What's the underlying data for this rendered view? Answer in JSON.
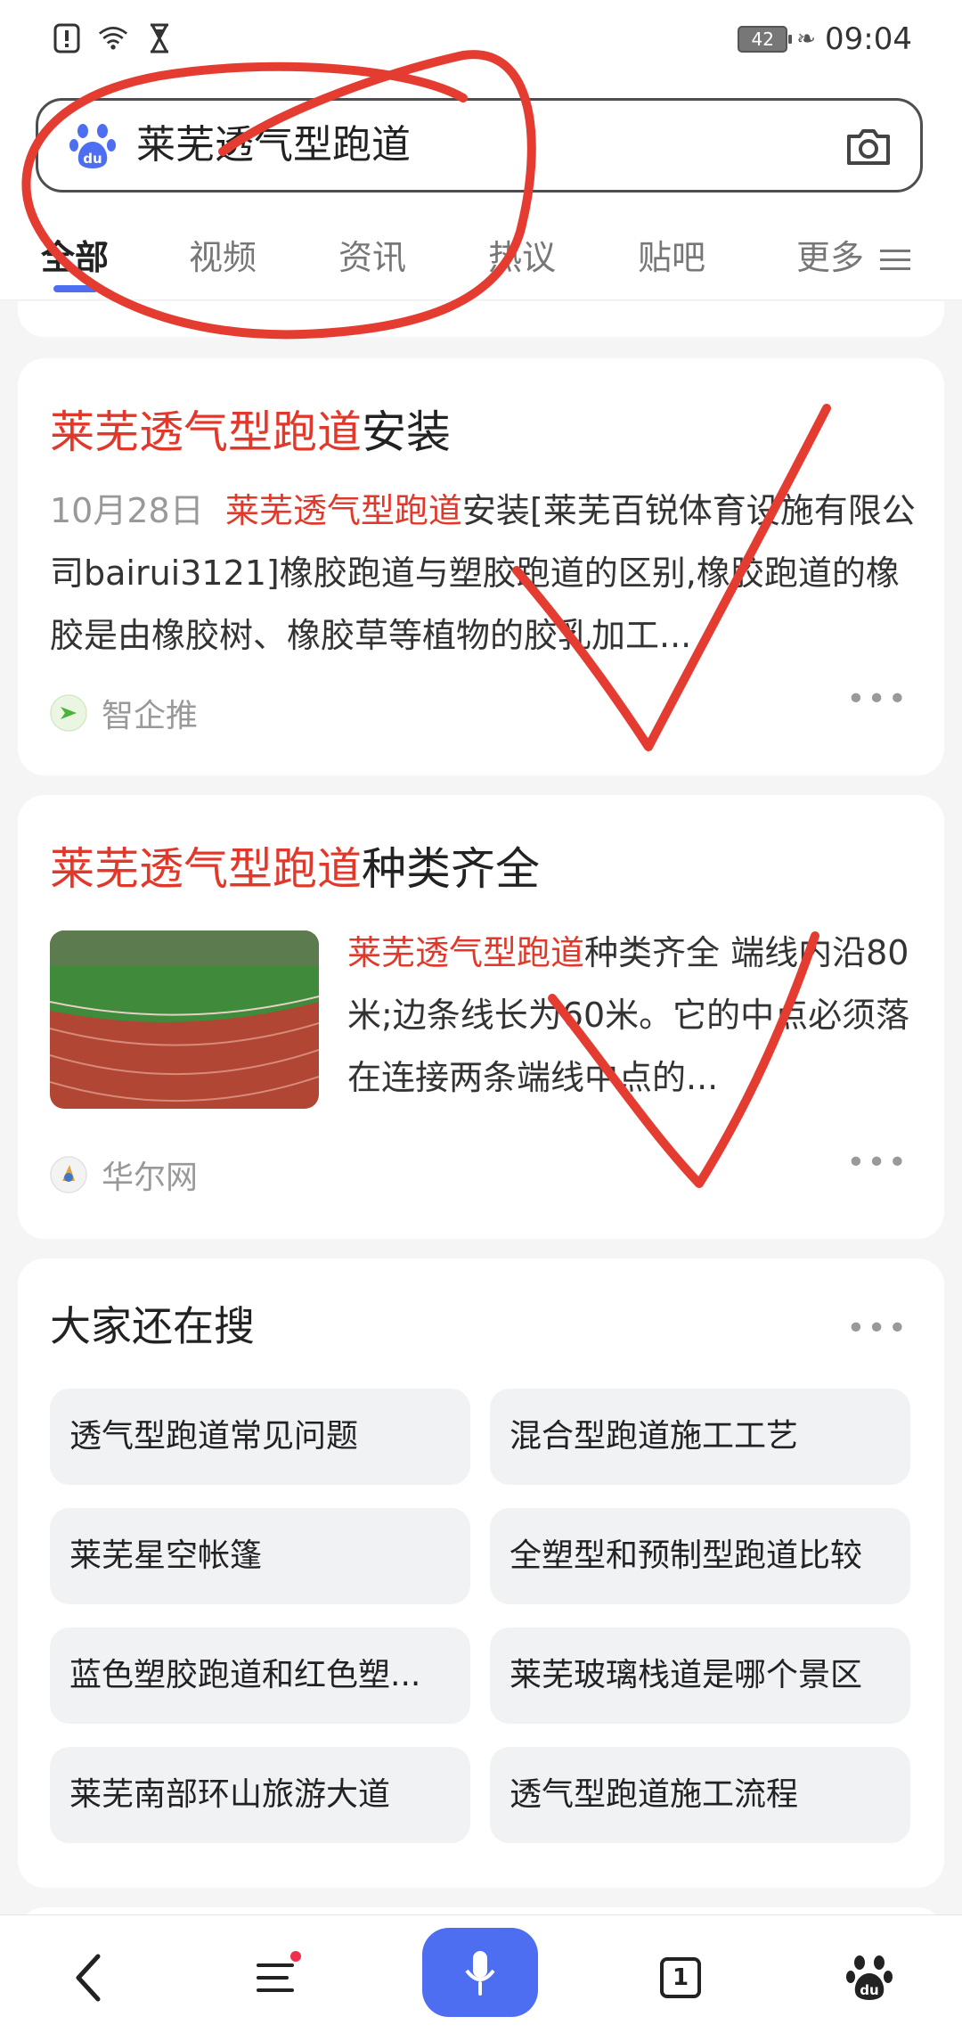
{
  "status_bar": {
    "battery": "42",
    "time": "09:04"
  },
  "search": {
    "query": "莱芜透气型跑道"
  },
  "tabs": [
    {
      "label": "全部",
      "active": true
    },
    {
      "label": "视频"
    },
    {
      "label": "资讯"
    },
    {
      "label": "热议"
    },
    {
      "label": "贴吧"
    },
    {
      "label": "更多"
    }
  ],
  "result1": {
    "title_highlight": "莱芜透气型跑道",
    "title_rest": "安装",
    "date": "10月28日",
    "desc_highlight": "莱芜透气型跑道",
    "desc_rest": "安装[莱芜百锐体育设施有限公司bairui3121]橡胶跑道与塑胶跑道的区别,橡胶跑道的橡胶是由橡胶树、橡胶草等植物的胶乳加工...",
    "source": "智企推"
  },
  "result2": {
    "title_highlight": "莱芜透气型跑道",
    "title_rest": "种类齐全",
    "desc_highlight": "莱芜透气型跑道",
    "desc_rest": "种类齐全 端线内沿80米;边条线长为60米。它的中点必须落在连接两条端线中点的...",
    "source": "华尔网"
  },
  "related": {
    "heading": "大家还在搜",
    "items": [
      "透气型跑道常见问题",
      "混合型跑道施工工艺",
      "莱芜星空帐篷",
      "全塑型和预制型跑道比较",
      "蓝色塑胶跑道和红色塑...",
      "莱芜玻璃栈道是哪个景区",
      "莱芜南部环山旅游大道",
      "透气型跑道施工流程"
    ]
  },
  "bottom_nav": {
    "tab_count": "1"
  },
  "colors": {
    "accent": "#4e6ef2",
    "highlight": "#e0392b",
    "annotation": "#e53c32"
  }
}
